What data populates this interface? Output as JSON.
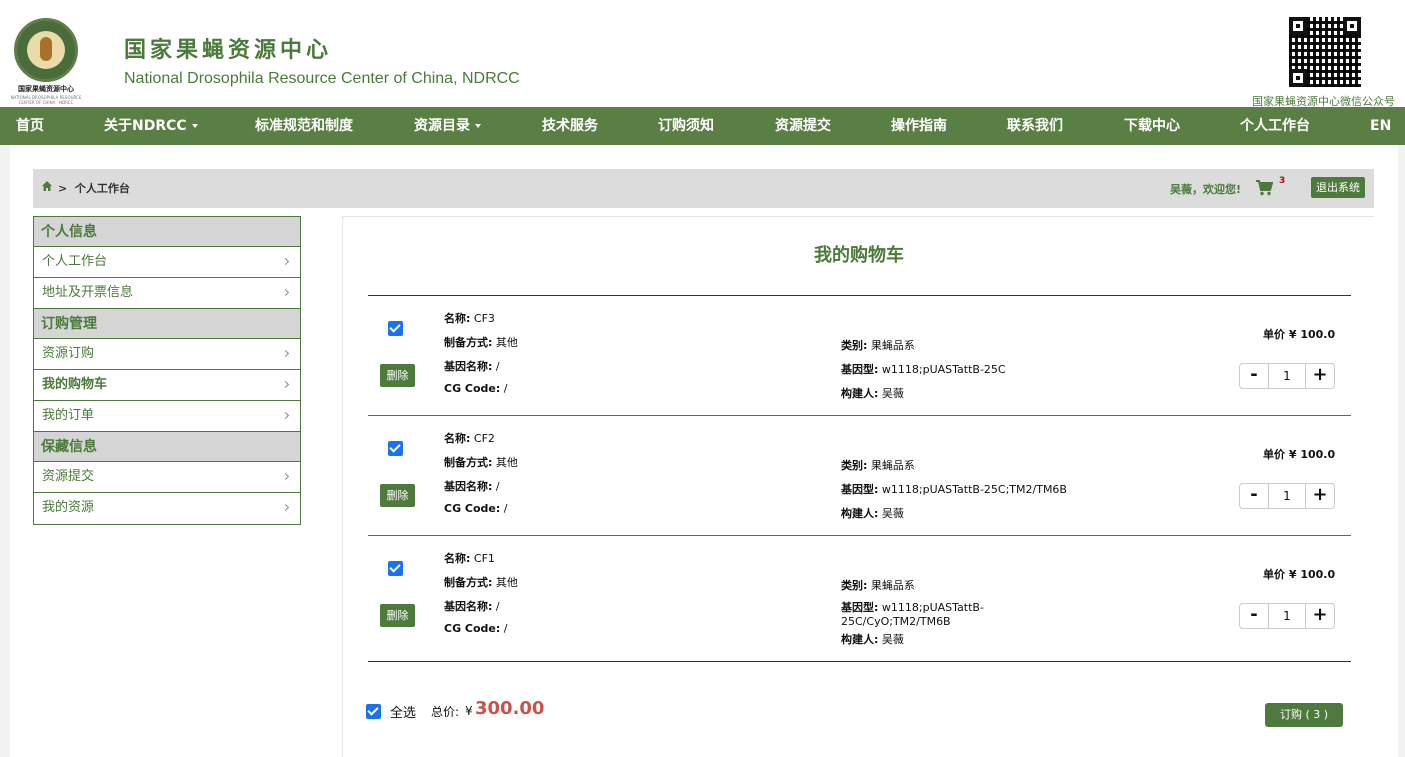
{
  "header": {
    "title_cn": "国家果蝇资源中心",
    "title_en": "National Drosophila Resource Center of China, NDRCC",
    "logo_caption": "国家果蝇资源中心",
    "logo_caption_en": "NATIONAL DROSOPHILA RESOURCE CENTER OF CHINA · NDRCC",
    "qr_caption": "国家果蝇资源中心微信公众号"
  },
  "nav": {
    "items": [
      {
        "label": "首页",
        "dropdown": false
      },
      {
        "label": "关于NDRCC",
        "dropdown": true
      },
      {
        "label": "标准规范和制度",
        "dropdown": false
      },
      {
        "label": "资源目录",
        "dropdown": true
      },
      {
        "label": "技术服务",
        "dropdown": false
      },
      {
        "label": "订购须知",
        "dropdown": false
      },
      {
        "label": "资源提交",
        "dropdown": false
      },
      {
        "label": "操作指南",
        "dropdown": false
      },
      {
        "label": "联系我们",
        "dropdown": false
      },
      {
        "label": "下载中心",
        "dropdown": false
      },
      {
        "label": "个人工作台",
        "dropdown": false
      },
      {
        "label": "EN",
        "dropdown": false
      }
    ]
  },
  "breadcrumb": {
    "separator": ">",
    "current": "个人工作台",
    "welcome": "吴薇，欢迎您!",
    "cart_count": "3",
    "logout_label": "退出系统"
  },
  "sidebar": {
    "groups": [
      {
        "title": "个人信息",
        "items": [
          {
            "label": "个人工作台"
          },
          {
            "label": "地址及开票信息"
          }
        ]
      },
      {
        "title": "订购管理",
        "items": [
          {
            "label": "资源订购"
          },
          {
            "label": "我的购物车"
          },
          {
            "label": "我的订单"
          }
        ]
      },
      {
        "title": "保藏信息",
        "items": [
          {
            "label": "资源提交"
          },
          {
            "label": "我的资源"
          }
        ]
      }
    ]
  },
  "cart": {
    "title": "我的购物车",
    "labels": {
      "name": "名称:",
      "prep": "制备方式:",
      "gene": "基因名称:",
      "cg": "CG Code:",
      "category": "类别:",
      "genotype": "基因型:",
      "builder": "构建人:",
      "unit_price": "单价",
      "delete": "删除"
    },
    "items": [
      {
        "name": "CF3",
        "prep": "其他",
        "gene": "/",
        "cg": "/",
        "category": "果蝇品系",
        "genotype": "w1118;pUASTattB-25C",
        "builder": "吴薇",
        "price": "¥ 100.0",
        "qty": "1",
        "checked": true
      },
      {
        "name": "CF2",
        "prep": "其他",
        "gene": "/",
        "cg": "/",
        "category": "果蝇品系",
        "genotype": "w1118;pUASTattB-25C;TM2/TM6B",
        "builder": "吴薇",
        "price": "¥ 100.0",
        "qty": "1",
        "checked": true
      },
      {
        "name": "CF1",
        "prep": "其他",
        "gene": "/",
        "cg": "/",
        "category": "果蝇品系",
        "genotype": "w1118;pUASTattB-25C/CyO;TM2/TM6B",
        "builder": "吴薇",
        "price": "¥ 100.0",
        "qty": "1",
        "checked": true
      }
    ],
    "select_all_label": "全选",
    "total_label": "总价:",
    "currency": "¥",
    "total_value": "300.00",
    "order_label": "订购 ( 3 )"
  },
  "colors": {
    "brand_green": "#5a7f45",
    "price_red": "#c9534b",
    "checkbox_blue": "#1a73e8"
  }
}
